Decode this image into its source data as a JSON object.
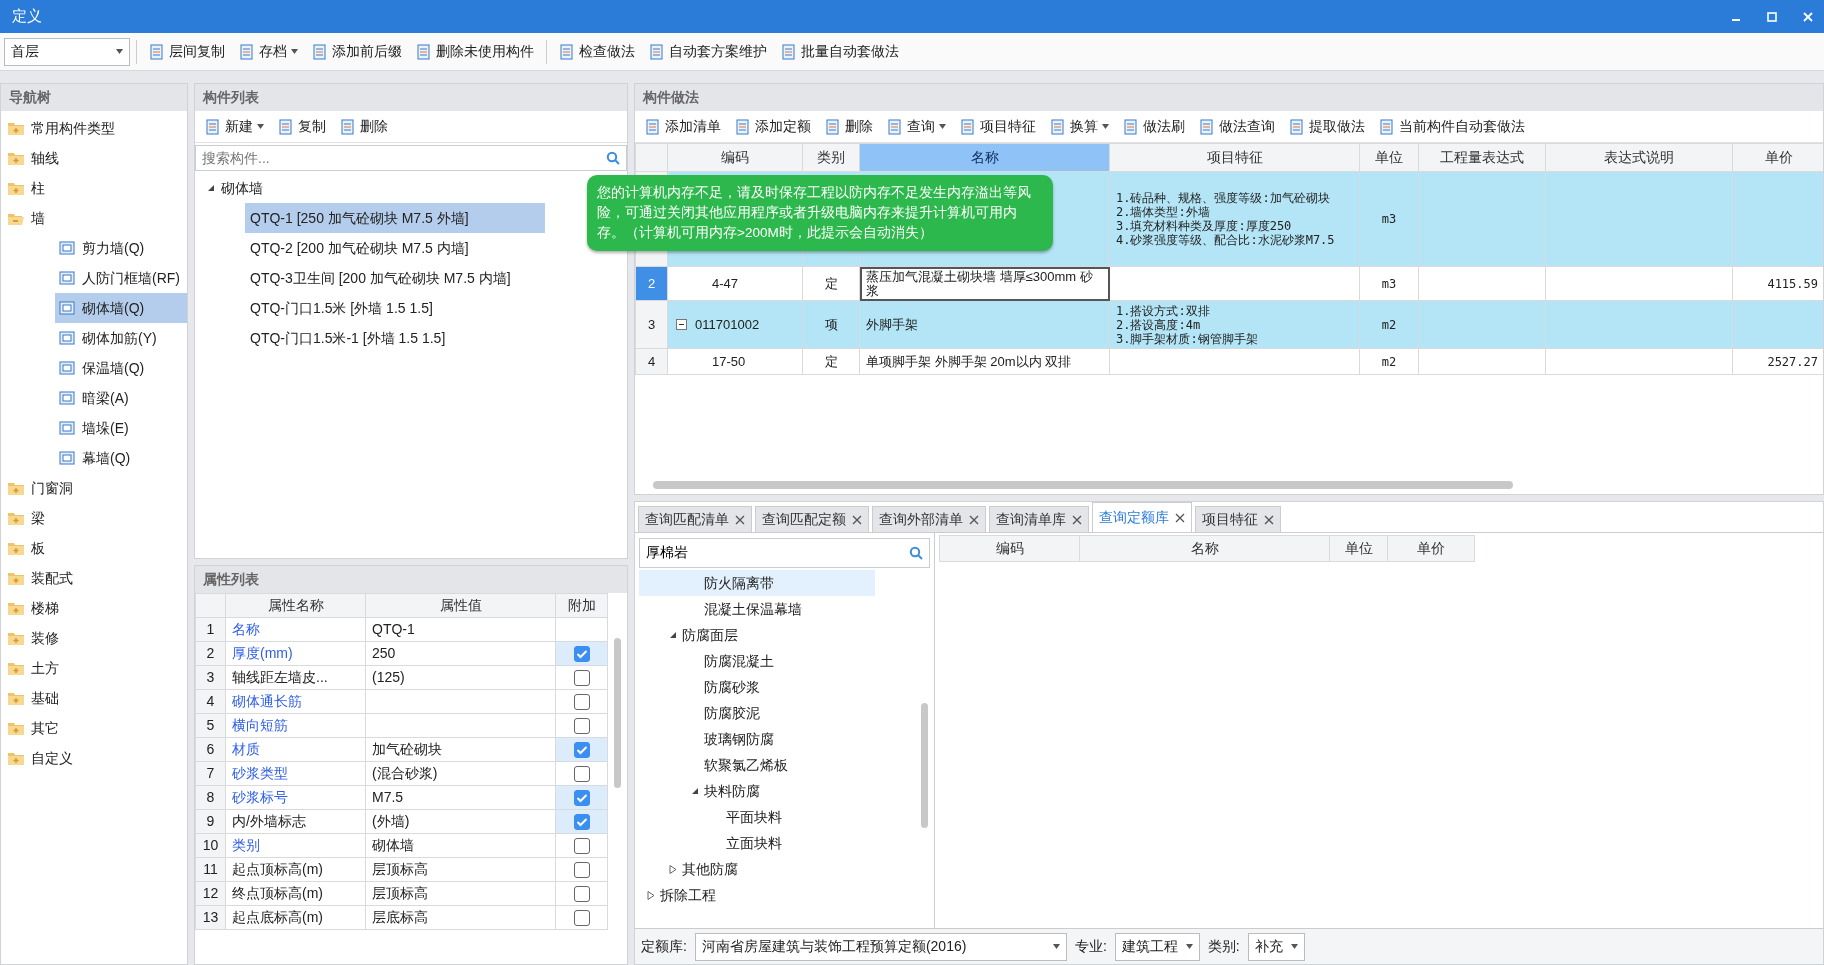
{
  "window": {
    "title": "定义"
  },
  "toolbar": {
    "floor": "首层",
    "groups": [
      [
        {
          "label": "层间复制",
          "dropdown": false
        },
        {
          "label": "存档",
          "dropdown": true
        },
        {
          "label": "添加前后缀",
          "dropdown": false
        },
        {
          "label": "删除未使用构件",
          "dropdown": false
        }
      ],
      [
        {
          "label": "检查做法",
          "dropdown": false
        },
        {
          "label": "自动套方案维护",
          "dropdown": false
        },
        {
          "label": "批量自动套做法",
          "dropdown": false
        }
      ]
    ]
  },
  "nav_tree": {
    "title": "导航树",
    "items": [
      {
        "label": "常用构件类型",
        "expanded": false,
        "selected": false
      },
      {
        "label": "轴线",
        "expanded": false,
        "selected": false
      },
      {
        "label": "柱",
        "expanded": false,
        "selected": false
      },
      {
        "label": "墙",
        "expanded": true,
        "selected": false,
        "children": [
          {
            "label": "剪力墙(Q)",
            "selected": false
          },
          {
            "label": "人防门框墙(RF)",
            "selected": false
          },
          {
            "label": "砌体墙(Q)",
            "selected": true
          },
          {
            "label": "砌体加筋(Y)",
            "selected": false
          },
          {
            "label": "保温墙(Q)",
            "selected": false
          },
          {
            "label": "暗梁(A)",
            "selected": false
          },
          {
            "label": "墙垛(E)",
            "selected": false
          },
          {
            "label": "幕墙(Q)",
            "selected": false
          }
        ]
      },
      {
        "label": "门窗洞",
        "expanded": false,
        "selected": false
      },
      {
        "label": "梁",
        "expanded": false,
        "selected": false
      },
      {
        "label": "板",
        "expanded": false,
        "selected": false
      },
      {
        "label": "装配式",
        "expanded": false,
        "selected": false
      },
      {
        "label": "楼梯",
        "expanded": false,
        "selected": false
      },
      {
        "label": "装修",
        "expanded": false,
        "selected": false
      },
      {
        "label": "土方",
        "expanded": false,
        "selected": false
      },
      {
        "label": "基础",
        "expanded": false,
        "selected": false
      },
      {
        "label": "其它",
        "expanded": false,
        "selected": false
      },
      {
        "label": "自定义",
        "expanded": false,
        "selected": false
      }
    ]
  },
  "component_list": {
    "title": "构件列表",
    "buttons": [
      {
        "label": "新建",
        "dropdown": true
      },
      {
        "label": "复制",
        "dropdown": false
      },
      {
        "label": "删除",
        "dropdown": false
      }
    ],
    "search": {
      "placeholder": "搜索构件..."
    },
    "tree": [
      {
        "label": "砌体墙",
        "expanded": true,
        "children": [
          {
            "label": "QTQ-1 [250 加气砼砌块 M7.5 外墙]",
            "selected": true
          },
          {
            "label": "QTQ-2 [200 加气砼砌块 M7.5 内墙]",
            "selected": false
          },
          {
            "label": "QTQ-3卫生间 [200 加气砼砌块 M7.5 内墙]",
            "selected": false
          },
          {
            "label": "QTQ-门口1.5米 [外墙 1.5 1.5]",
            "selected": false
          },
          {
            "label": "QTQ-门口1.5米-1 [外墙 1.5 1.5]",
            "selected": false
          }
        ]
      }
    ]
  },
  "property_list": {
    "title": "属性列表",
    "columns": [
      "属性名称",
      "属性值",
      "附加"
    ],
    "rows": [
      {
        "num": "1",
        "name": "名称",
        "public": true,
        "value": "QTQ-1"
      },
      {
        "num": "2",
        "name": "厚度(mm)",
        "public": true,
        "value": "250",
        "checked": true
      },
      {
        "num": "3",
        "name": "轴线距左墙皮...",
        "public": false,
        "value": "(125)",
        "checked": false
      },
      {
        "num": "4",
        "name": "砌体通长筋",
        "public": true,
        "checked": false
      },
      {
        "num": "5",
        "name": "横向短筋",
        "public": true,
        "checked": false
      },
      {
        "num": "6",
        "name": "材质",
        "public": true,
        "value": "加气砼砌块",
        "checked": true
      },
      {
        "num": "7",
        "name": "砂浆类型",
        "public": true,
        "value": "(混合砂浆)",
        "checked": false
      },
      {
        "num": "8",
        "name": "砂浆标号",
        "public": true,
        "value": "M7.5",
        "checked": true
      },
      {
        "num": "9",
        "name": "内/外墙标志",
        "public": false,
        "value": "(外墙)",
        "checked": true
      },
      {
        "num": "10",
        "name": "类别",
        "public": true,
        "value": "砌体墙",
        "checked": false
      },
      {
        "num": "11",
        "name": "起点顶标高(m)",
        "public": false,
        "value": "层顶标高",
        "checked": false
      },
      {
        "num": "12",
        "name": "终点顶标高(m)",
        "public": false,
        "value": "层顶标高",
        "checked": false
      },
      {
        "num": "13",
        "name": "起点底标高(m)",
        "public": false,
        "value": "层底标高",
        "checked": false
      }
    ]
  },
  "methods": {
    "title": "构件做法",
    "buttons": [
      {
        "label": "添加清单",
        "dropdown": false
      },
      {
        "label": "添加定额",
        "dropdown": false
      },
      {
        "label": "删除",
        "dropdown": false
      },
      {
        "label": "查询",
        "dropdown": true
      },
      {
        "label": "项目特征",
        "dropdown": false
      },
      {
        "label": "换算",
        "dropdown": true
      },
      {
        "label": "做法刷",
        "dropdown": false
      },
      {
        "label": "做法查询",
        "dropdown": false
      },
      {
        "label": "提取做法",
        "dropdown": false
      },
      {
        "label": "当前构件自动套做法",
        "dropdown": false
      }
    ],
    "columns": [
      {
        "label": "编码",
        "selected": false
      },
      {
        "label": "类别",
        "selected": false
      },
      {
        "label": "名称",
        "selected": true
      },
      {
        "label": "项目特征",
        "selected": false
      },
      {
        "label": "单位",
        "selected": false
      },
      {
        "label": "工程量表达式",
        "selected": false
      },
      {
        "label": "表达式说明",
        "selected": false
      },
      {
        "label": "单价",
        "selected": false
      }
    ],
    "rows": [
      {
        "kind": "item",
        "selected": false,
        "features": [
          "1.砖品种、规格、强度等级:加气砼砌块",
          "2.墙体类型:外墙",
          "3.填充材料种类及厚度:厚度250",
          "4.砂浆强度等级、配合比:水泥砂浆M7.5"
        ],
        "unit": "m3"
      },
      {
        "kind": "quota",
        "selected": true,
        "num": "2",
        "code": "4-47",
        "type": "定",
        "name": "蒸压加气混凝土砌块墙 墙厚≤300mm 砂浆",
        "unit": "m3",
        "price": "4115.59"
      },
      {
        "kind": "item",
        "selected": false,
        "num": "3",
        "expanded": true,
        "code": "011701002",
        "type": "项",
        "name": "外脚手架",
        "features": [
          "1.搭设方式:双排",
          "2.搭设高度:4m",
          "3.脚手架材质:钢管脚手架"
        ],
        "unit": "m2"
      },
      {
        "kind": "quota",
        "selected": false,
        "num": "4",
        "code": "17-50",
        "type": "定",
        "name": "单项脚手架 外脚手架 20m以内 双排",
        "unit": "m2",
        "price": "2527.27"
      }
    ]
  },
  "notification": "您的计算机内存不足，请及时保存工程以防内存不足发生内存溢出等风险，可通过关闭其他应用程序或者升级电脑内存来提升计算机可用内存。（计算机可用内存>200M时，此提示会自动消失）",
  "query": {
    "tabs": [
      {
        "label": "查询匹配清单",
        "selected": false
      },
      {
        "label": "查询匹配定额",
        "selected": false
      },
      {
        "label": "查询外部清单",
        "selected": false
      },
      {
        "label": "查询清单库",
        "selected": false
      },
      {
        "label": "查询定额库",
        "selected": true
      },
      {
        "label": "项目特征",
        "selected": false
      }
    ],
    "search": {
      "value": "厚棉岩"
    },
    "tree": [
      {
        "children": [
          {
            "children": [
              {
                "label": "防火隔离带",
                "selected": true
              },
              {
                "label": "混凝土保温幕墙",
                "selected": false
              }
            ]
          },
          {
            "label": "防腐面层",
            "expanded": true,
            "selected": false,
            "children": [
              {
                "label": "防腐混凝土",
                "selected": false
              },
              {
                "label": "防腐砂浆",
                "selected": false
              },
              {
                "label": "防腐胶泥",
                "selected": false
              },
              {
                "label": "玻璃钢防腐",
                "selected": false
              },
              {
                "label": "软聚氯乙烯板",
                "selected": false
              },
              {
                "label": "块料防腐",
                "expanded": true,
                "selected": false,
                "children": [
                  {
                    "label": "平面块料",
                    "selected": false
                  },
                  {
                    "label": "立面块料",
                    "selected": false
                  }
                ]
              }
            ]
          },
          {
            "label": "其他防腐",
            "expanded": false,
            "selected": false
          }
        ]
      },
      {
        "label": "拆除工程",
        "expanded": false,
        "selected": false
      }
    ],
    "result_columns": [
      "编码",
      "名称",
      "单位",
      "单价"
    ],
    "filters": [
      {
        "label": "定额库:",
        "value": "河南省房屋建筑与装饰工程预算定额(2016)"
      },
      {
        "label": "专业:",
        "value": "建筑工程"
      },
      {
        "label": "类别:",
        "value": "补充"
      }
    ]
  }
}
